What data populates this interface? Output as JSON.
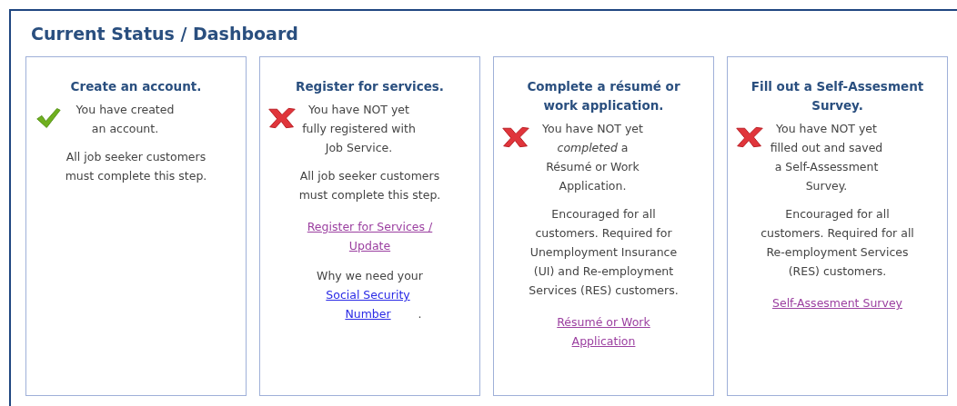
{
  "panel": {
    "title": "Current Status / Dashboard"
  },
  "cards": [
    {
      "title": "Create an account.",
      "done": true,
      "status": "You have created an account.",
      "description": "All job seeker customers must complete this step."
    },
    {
      "title": "Register for services.",
      "done": false,
      "status": "You have NOT yet fully registered with Job Service.",
      "description": "All job seeker customers must complete this step.",
      "link": {
        "text": "Register for Services / Update",
        "visited": true
      },
      "note": {
        "text": "Why we need your",
        "link": {
          "text": "Social Security Number",
          "visited": false
        },
        "suffix": "."
      }
    },
    {
      "title": "Complete a résumé or work application.",
      "done": false,
      "status": "You have NOT yet *completed* a Résumé or Work Application.",
      "description": "Encouraged for all customers. Required for Unemployment Insurance (UI) and Re-employment Services (RES) customers.",
      "link": {
        "text": "Résumé or Work Application",
        "visited": true
      }
    },
    {
      "title": "Fill out a Self-Assesment Survey.",
      "done": false,
      "status": "You have NOT yet filled out and saved a Self-Assessment Survey.",
      "description": "Encouraged for all customers. Required for all Re-employment Services (RES) customers.",
      "link": {
        "text": "Self-Assesment Survey",
        "visited": true
      }
    }
  ]
}
